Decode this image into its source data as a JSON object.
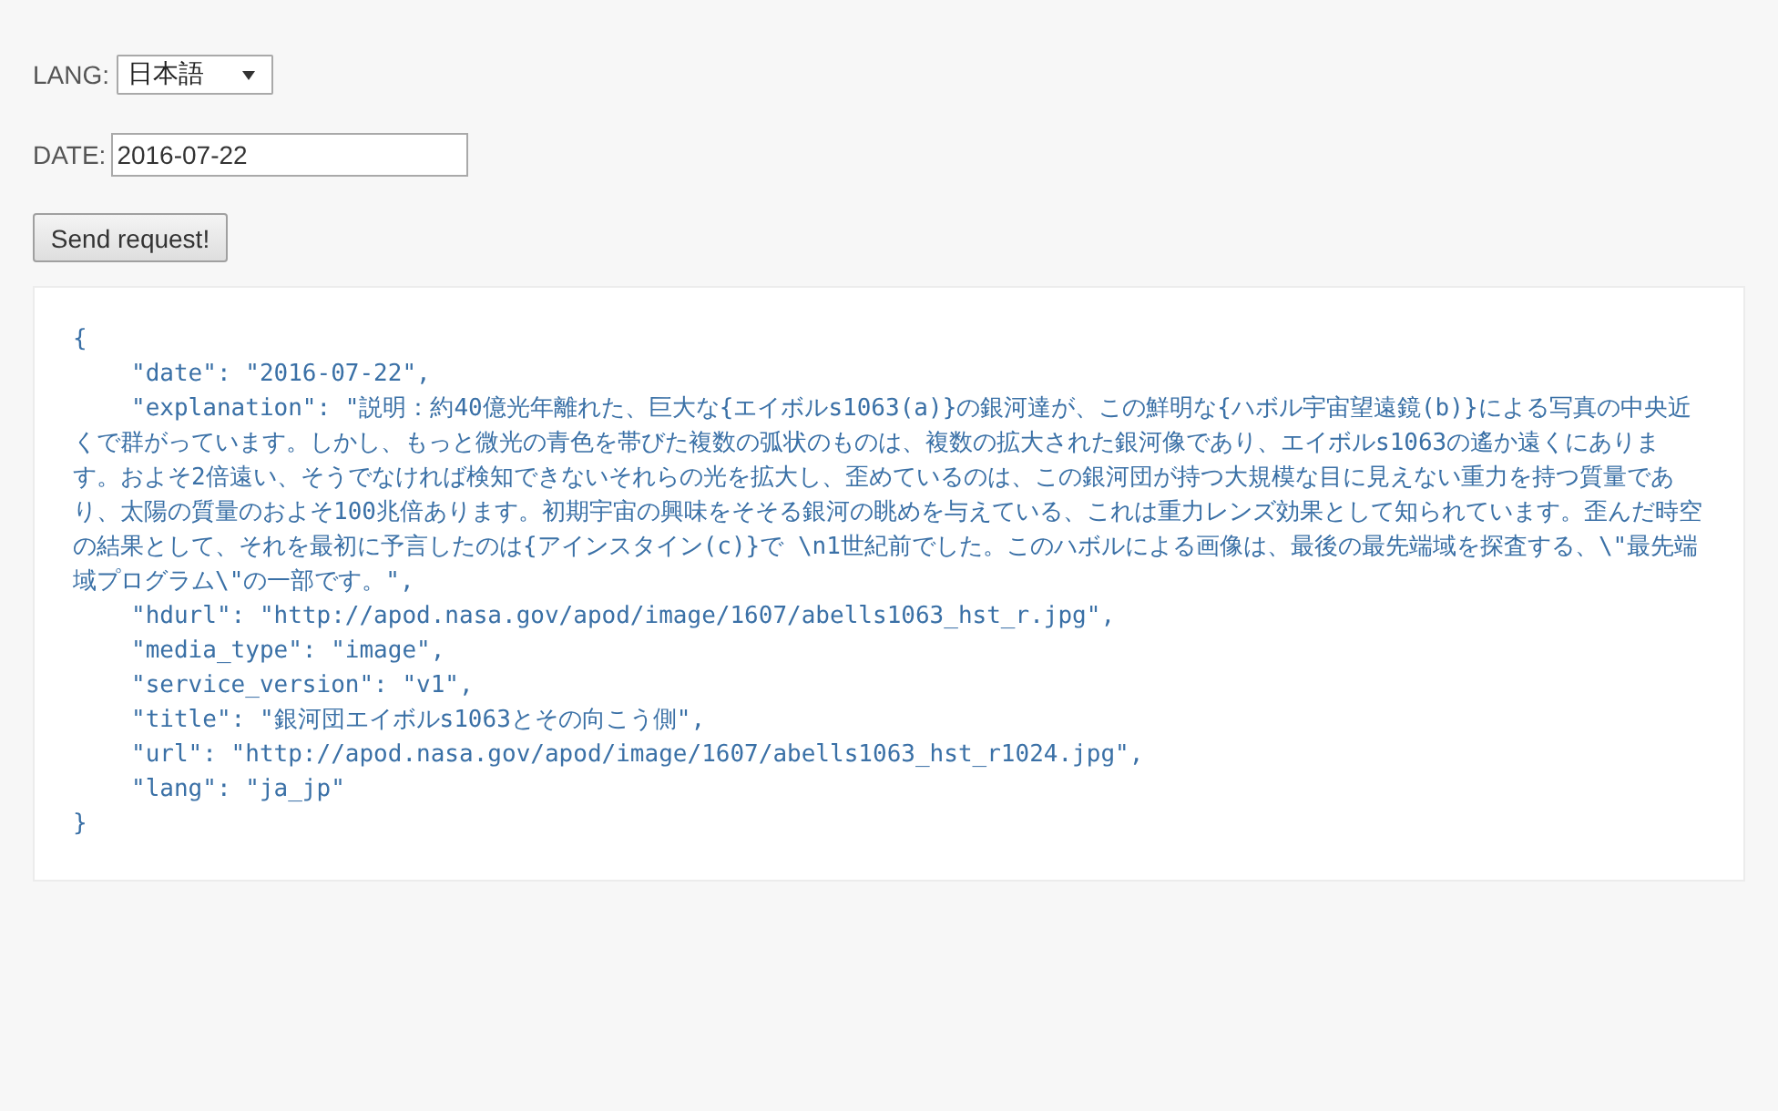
{
  "lang_field": {
    "label": "LANG:",
    "value": "日本語"
  },
  "date_field": {
    "label": "DATE:",
    "value": "2016-07-22"
  },
  "send_button": {
    "label": "Send request!"
  },
  "response": {
    "open": "{",
    "entries": [
      "\"date\": \"2016-07-22\",",
      "\"explanation\": \"説明：約40億光年離れた、巨大な{エイボルs1063(a)}の銀河達が、この鮮明な{ハボル宇宙望遠鏡(b)}による写真の中央近くで群がっています。しかし、もっと微光の青色を帯びた複数の弧状のものは、複数の拡大された銀河像であり、エイボルs1063の遙か遠くにあります。およそ2倍遠い、そうでなければ検知できないそれらの光を拡大し、歪めているのは、この銀河団が持つ大規模な目に見えない重力を持つ質量であり、太陽の質量のおよそ100兆倍あります。初期宇宙の興味をそそる銀河の眺めを与えている、これは重力レンズ効果として知られています。歪んだ時空の結果として、それを最初に予言したのは{アインスタイン(c)}で \\n1世紀前でした。このハボルによる画像は、最後の最先端域を探査する、\\\"最先端域プログラム\\\"の一部です。\",",
      "\"hdurl\": \"http://apod.nasa.gov/apod/image/1607/abells1063_hst_r.jpg\",",
      "\"media_type\": \"image\",",
      "\"service_version\": \"v1\",",
      "\"title\": \"銀河団エイボルs1063とその向こう側\",",
      "\"url\": \"http://apod.nasa.gov/apod/image/1607/abells1063_hst_r1024.jpg\",",
      "\"lang\": \"ja_jp\""
    ],
    "close": "}"
  }
}
